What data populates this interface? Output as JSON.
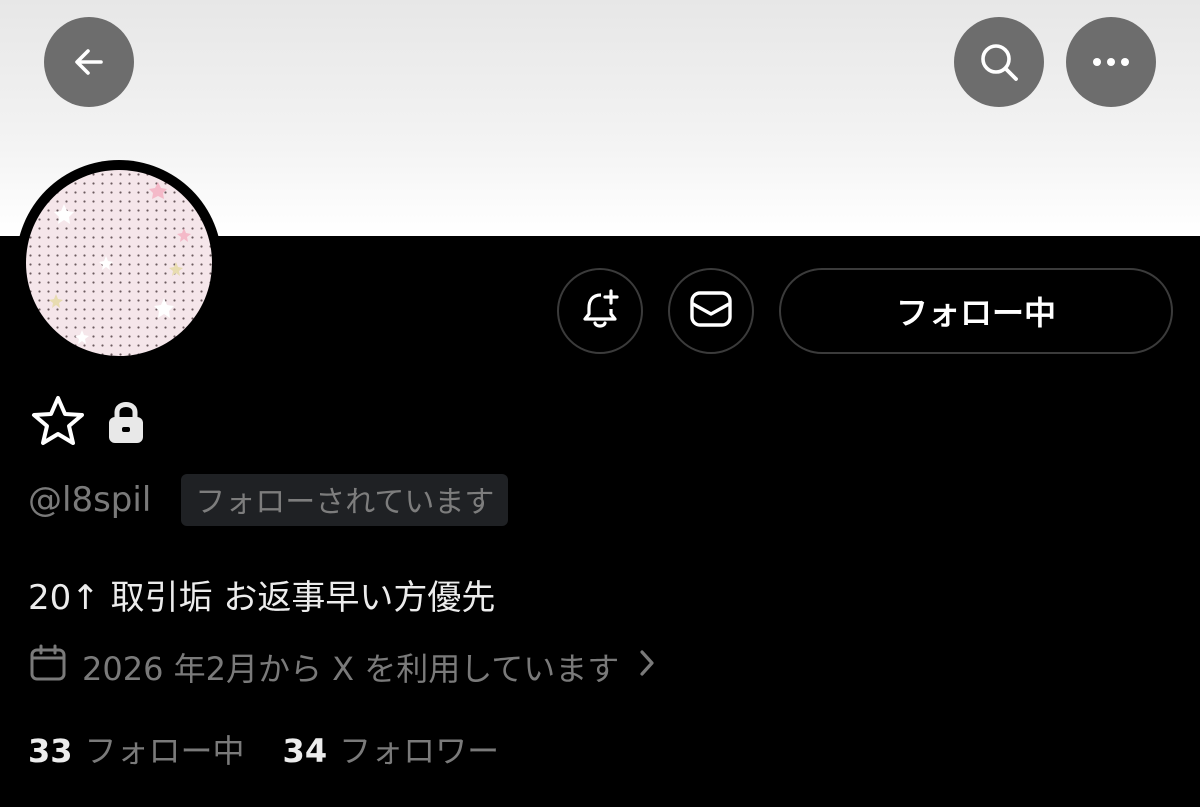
{
  "header": {
    "back_icon": "arrow-left-icon",
    "search_icon": "search-icon",
    "more_icon": "more-horizontal-icon"
  },
  "profile": {
    "display_name_icons": [
      "star-icon",
      "lock-icon"
    ],
    "handle": "@l8spil",
    "follows_you_badge": "フォローされています",
    "bio": "20↑ 取引垢 お返事早い方優先",
    "joined": "2026 年2月から X を利用しています",
    "following_count": "33",
    "following_label": "フォロー中",
    "followers_count": "34",
    "followers_label": "フォロワー"
  },
  "actions": {
    "notify_icon": "bell-plus-icon",
    "message_icon": "envelope-icon",
    "follow_label": "フォロー中"
  },
  "colors": {
    "background": "#000000",
    "secondary_text": "#7a7a7a",
    "primary_text": "#ececec",
    "button_border": "#3b3b3b"
  }
}
